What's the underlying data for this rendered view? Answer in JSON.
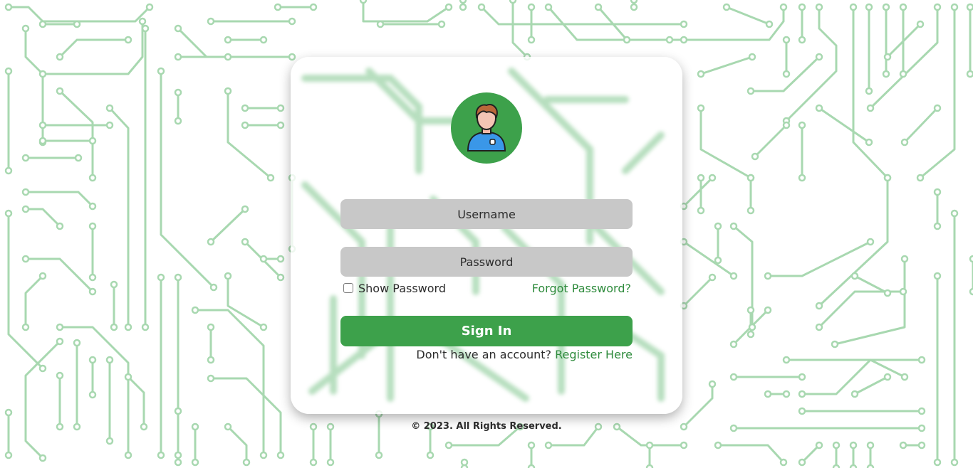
{
  "colors": {
    "accent": "#3da14b",
    "link": "#2e8b3c",
    "circuit": "#a8d8b0",
    "input_bg": "#c8c8c8"
  },
  "avatar": {
    "icon": "user-avatar-icon"
  },
  "form": {
    "username_placeholder": "Username",
    "password_placeholder": "Password",
    "show_password_label": "Show Password",
    "show_password_checked": false,
    "forgot_password": "Forgot Password?",
    "sign_in": "Sign In",
    "no_account": "Don't have an account?",
    "register": "Register Here"
  },
  "footer": {
    "text": "© 2023. All Rights Reserved."
  }
}
